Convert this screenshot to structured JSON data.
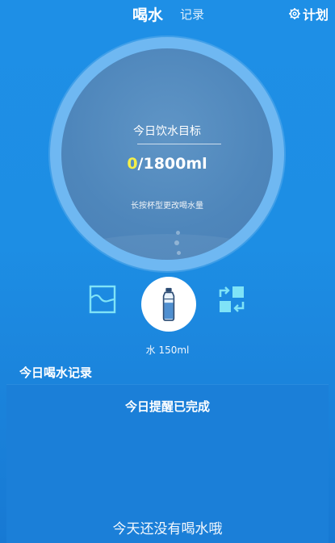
{
  "header": {
    "active_tab": "喝水",
    "inactive_tab": "记录",
    "plan_label": "计划",
    "plan_icon": "gear-icon"
  },
  "goal": {
    "title": "今日饮水目标",
    "current": "0",
    "target": "/1800ml",
    "hint": "长按杯型更改喝水量"
  },
  "controls": {
    "left_icon": "chart-icon",
    "cup_icon": "water-bottle-icon",
    "right_icon": "swap-icon",
    "cup_label": "水 150ml"
  },
  "records": {
    "title": "今日喝水记录",
    "reminder": "今日提醒已完成",
    "empty_message": "今天还没有喝水哦"
  },
  "colors": {
    "background": "#1d8ee4",
    "accent_yellow": "#f5ef48",
    "ring": "#6fb8f2",
    "panel": "#1b7fd8"
  }
}
